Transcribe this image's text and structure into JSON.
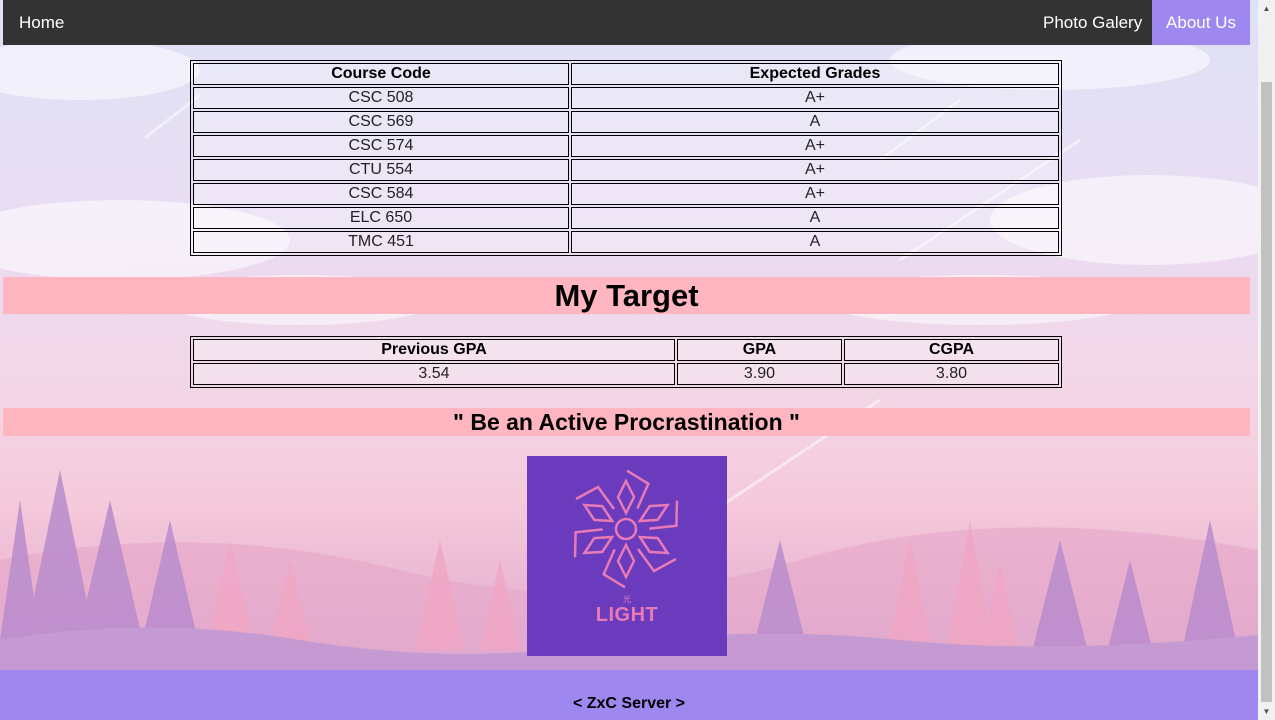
{
  "nav": {
    "home": "Home",
    "gallery": "Photo Galery",
    "about": "About Us"
  },
  "grades_table": {
    "headers": [
      "Course Code",
      "Expected Grades"
    ],
    "rows": [
      [
        "CSC 508",
        "A+"
      ],
      [
        "CSC 569",
        "A"
      ],
      [
        "CSC 574",
        "A+"
      ],
      [
        "CTU 554",
        "A+"
      ],
      [
        "CSC 584",
        "A+"
      ],
      [
        "ELC 650",
        "A"
      ],
      [
        "TMC 451",
        "A"
      ]
    ]
  },
  "target_banner": "My Target",
  "target_table": {
    "headers": [
      "Previous GPA",
      "GPA",
      "CGPA"
    ],
    "rows": [
      [
        "3.54",
        "3.90",
        "3.80"
      ]
    ]
  },
  "quote": "\" Be an Active Procrastination \"",
  "logo": {
    "text": "LIGHT",
    "small": "光"
  },
  "footer": "< ZxC Server >",
  "colors": {
    "navbar": "#333333",
    "active_nav": "#9f87f0",
    "banner": "#ffb6c1",
    "footer": "#9f87f0",
    "logo_bg": "#6a3bbd",
    "logo_fg": "#e87ab6"
  }
}
